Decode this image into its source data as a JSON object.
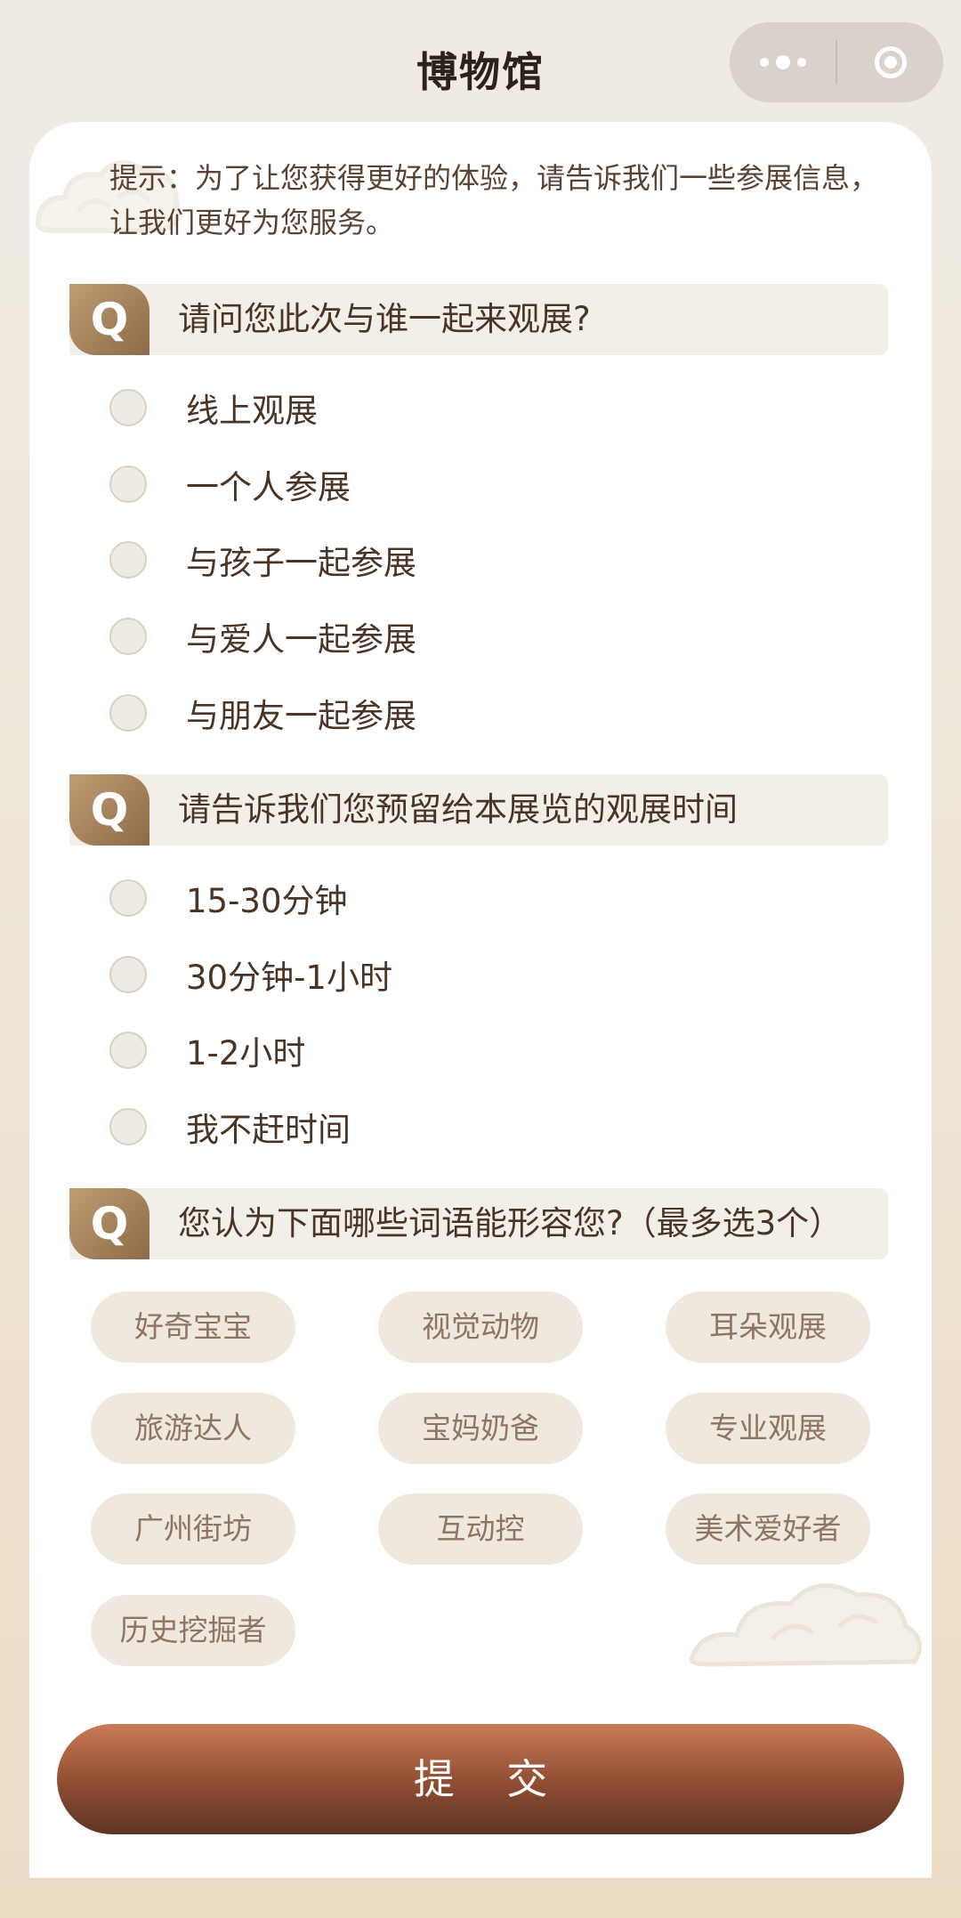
{
  "header": {
    "title": "博物馆",
    "more_icon": "more-dots-icon",
    "close_icon": "target-circle-icon"
  },
  "tip": "提示：为了让您获得更好的体验，请告诉我们一些参展信息，让我们更好为您服务。",
  "questions": [
    {
      "badge": "Q",
      "text": "请问您此次与谁一起来观展?",
      "options": [
        "线上观展",
        "一个人参展",
        "与孩子一起参展",
        "与爱人一起参展",
        "与朋友一起参展"
      ]
    },
    {
      "badge": "Q",
      "text": "请告诉我们您预留给本展览的观展时间",
      "options": [
        "15-30分钟",
        "30分钟-1小时",
        "1-2小时",
        "我不赶时间"
      ]
    },
    {
      "badge": "Q",
      "text": "您认为下面哪些词语能形容您?（最多选3个）",
      "tags": [
        "好奇宝宝",
        "视觉动物",
        "耳朵观展",
        "旅游达人",
        "宝妈奶爸",
        "专业观展",
        "广州街坊",
        "互动控",
        "美术爱好者",
        "历史挖掘者"
      ]
    }
  ],
  "submit_label": "提 交",
  "colors": {
    "accent": "#8e4c32",
    "badge": "#a8845c",
    "page_bg": "#efe7da"
  }
}
